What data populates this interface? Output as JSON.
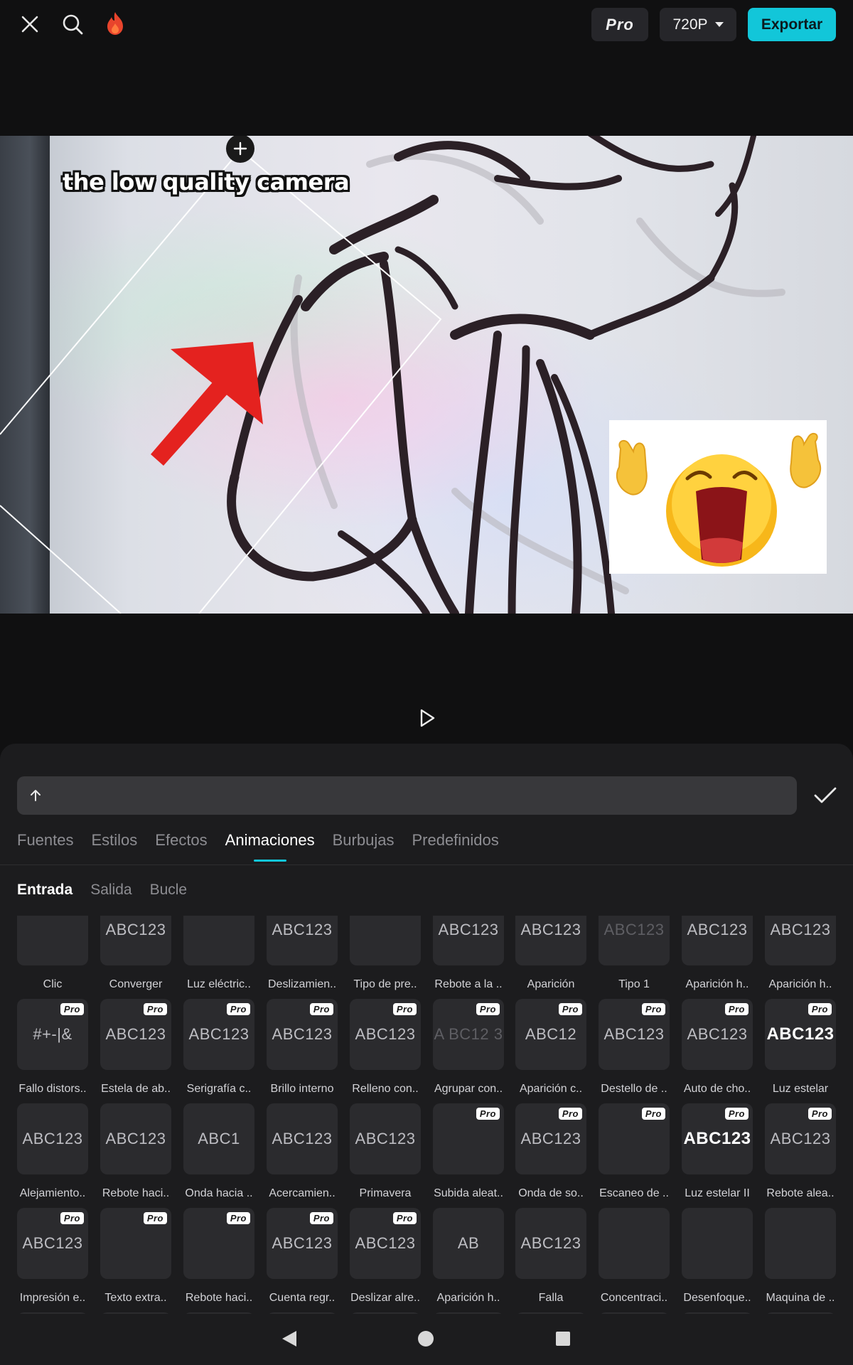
{
  "toolbar": {
    "pro_label": "Pro",
    "resolution_label": "720P",
    "export_label": "Exportar",
    "accent_color": "#12c6d9"
  },
  "preview": {
    "caption": "the low quality camera"
  },
  "editor": {
    "input_value": "",
    "tabs": [
      "Fuentes",
      "Estilos",
      "Efectos",
      "Animaciones",
      "Burbujas",
      "Predefinidos"
    ],
    "active_tab": "Animaciones",
    "subtabs": [
      "Entrada",
      "Salida",
      "Bucle"
    ],
    "active_subtab": "Entrada"
  },
  "animations": {
    "rows": [
      [
        {
          "label": "Clic",
          "thumb": "",
          "pro": false
        },
        {
          "label": "Converger",
          "thumb": "ABC123",
          "pro": false
        },
        {
          "label": "Luz eléctric..",
          "thumb": "",
          "pro": false
        },
        {
          "label": "Deslizamien..",
          "thumb": "ABC123",
          "pro": false
        },
        {
          "label": "Tipo de pre..",
          "thumb": "",
          "pro": false
        },
        {
          "label": "Rebote a la ..",
          "thumb": "ABC123",
          "pro": false
        },
        {
          "label": "Aparición",
          "thumb": "ABC123",
          "pro": false
        },
        {
          "label": "Tipo 1",
          "thumb": "ABC123",
          "pro": false
        },
        {
          "label": "Aparición h..",
          "thumb": "ABC123",
          "pro": false
        },
        {
          "label": "Aparición h..",
          "thumb": "ABC123",
          "pro": false
        }
      ],
      [
        {
          "label": "Fallo distors..",
          "thumb": "#+-|&",
          "pro": true
        },
        {
          "label": "Estela de ab..",
          "thumb": "ABC123",
          "pro": true
        },
        {
          "label": "Serigrafía c..",
          "thumb": "ABC123",
          "pro": true
        },
        {
          "label": "Brillo interno",
          "thumb": "ABC123",
          "pro": true
        },
        {
          "label": "Relleno con..",
          "thumb": "ABC123",
          "pro": true
        },
        {
          "label": "Agrupar con..",
          "thumb": "A BC12 3",
          "pro": true
        },
        {
          "label": "Aparición c..",
          "thumb": "ABC12",
          "pro": true
        },
        {
          "label": "Destello de ..",
          "thumb": "ABC123",
          "pro": true
        },
        {
          "label": "Auto de cho..",
          "thumb": "ABC123",
          "pro": true
        },
        {
          "label": "Luz estelar",
          "thumb": "ABC123",
          "pro": true
        }
      ],
      [
        {
          "label": "Alejamiento..",
          "thumb": "ABC123",
          "pro": false
        },
        {
          "label": "Rebote haci..",
          "thumb": "ABC123",
          "pro": false
        },
        {
          "label": "Onda hacia ..",
          "thumb": "ABC1",
          "pro": false
        },
        {
          "label": "Acercamien..",
          "thumb": "ABC123",
          "pro": false
        },
        {
          "label": "Primavera",
          "thumb": "ABC123",
          "pro": false
        },
        {
          "label": "Subida aleat..",
          "thumb": "",
          "pro": true
        },
        {
          "label": "Onda de so..",
          "thumb": "ABC123",
          "pro": true
        },
        {
          "label": "Escaneo de ..",
          "thumb": "",
          "pro": true
        },
        {
          "label": "Luz estelar II",
          "thumb": "ABC123",
          "pro": true
        },
        {
          "label": "Rebote alea..",
          "thumb": "ABC123",
          "pro": true
        }
      ],
      [
        {
          "label": "Impresión e..",
          "thumb": "ABC123",
          "pro": true
        },
        {
          "label": "Texto extra..",
          "thumb": "",
          "pro": true
        },
        {
          "label": "Rebote haci..",
          "thumb": "",
          "pro": true
        },
        {
          "label": "Cuenta regr..",
          "thumb": "ABC123",
          "pro": true
        },
        {
          "label": "Deslizar alre..",
          "thumb": "ABC123",
          "pro": true
        },
        {
          "label": "Aparición h..",
          "thumb": "AB",
          "pro": false
        },
        {
          "label": "Falla",
          "thumb": "ABC123",
          "pro": false
        },
        {
          "label": "Concentraci..",
          "thumb": "",
          "pro": false
        },
        {
          "label": "Desenfoque..",
          "thumb": "",
          "pro": false
        },
        {
          "label": "Maquina de ..",
          "thumb": "",
          "pro": false
        }
      ]
    ]
  }
}
